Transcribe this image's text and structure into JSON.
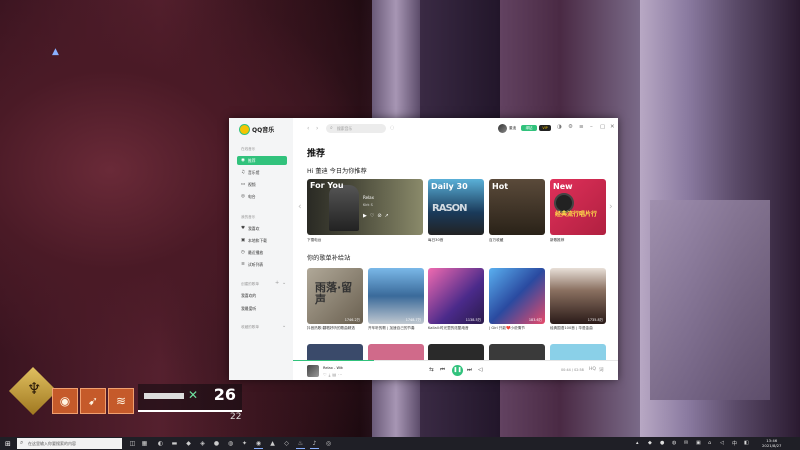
{
  "colors": {
    "accent": "#31c27c"
  },
  "hud": {
    "super_icon": "phoenix-super-icon",
    "ammo": "26",
    "reserve": "22"
  },
  "app": {
    "logo": "QQ音乐",
    "sidebar": {
      "section_online": "在线音乐",
      "items_online": [
        {
          "icon": "music-note-icon",
          "label": "推荐",
          "active": true
        },
        {
          "icon": "music-hall-icon",
          "label": "音乐馆"
        },
        {
          "icon": "video-icon",
          "label": "视频"
        },
        {
          "icon": "radio-icon",
          "label": "电台"
        }
      ],
      "section_mine": "我的音乐",
      "items_mine": [
        {
          "icon": "heart-icon",
          "label": "我喜欢"
        },
        {
          "icon": "download-icon",
          "label": "本地和下载"
        },
        {
          "icon": "clock-icon",
          "label": "最近播放"
        },
        {
          "icon": "list-icon",
          "label": "试听列表"
        }
      ],
      "section_created": "创建的歌单",
      "items_created": [
        "我喜欢的",
        "我最爱听"
      ],
      "section_collected": "收藏的歌单"
    },
    "top": {
      "search_placeholder": "搜索音乐",
      "username": "董迪",
      "vip_badge": "绿钻",
      "vip_badge2": "VIP"
    },
    "main": {
      "title": "推荐",
      "greeting": "Hi 董迪 今日为你推荐",
      "foryou": {
        "title": "For You",
        "song": "Relax",
        "artist": "Kirk S",
        "caption": "下雪电台"
      },
      "cards": [
        {
          "title": "Daily 30",
          "caption": "每日30首"
        },
        {
          "title": "Hot",
          "caption": "百万收藏"
        },
        {
          "title": "New",
          "sub": "经典流行唱片行",
          "caption": "新歌推荐"
        }
      ],
      "section2": "你的歌单补给站",
      "playlists": [
        {
          "art": "雨落·留声",
          "plays": "1746.2万",
          "caption": "抖音热歌:翻唱好听的歌曲精选"
        },
        {
          "plays": "1748.7万",
          "caption": "开车听的歌 | 加速自己的节奏"
        },
        {
          "plays": "1138.5万",
          "caption": "Kallall:时光里的炫酷电音"
        },
        {
          "plays": "183.6万",
          "caption": "| Girl 只能❤️小说情节"
        },
        {
          "plays": "1735.8万",
          "caption": "经典国语100首 | 华语金曲"
        }
      ]
    },
    "player": {
      "song": "Relax - Wik",
      "time": "00:44 / 02:58",
      "quality": "HQ",
      "progress": 0.25
    }
  },
  "taskbar": {
    "search_placeholder": "在这里输入你要搜索的内容",
    "time": "13:46",
    "date": "2021/8/27",
    "lang": "中"
  }
}
